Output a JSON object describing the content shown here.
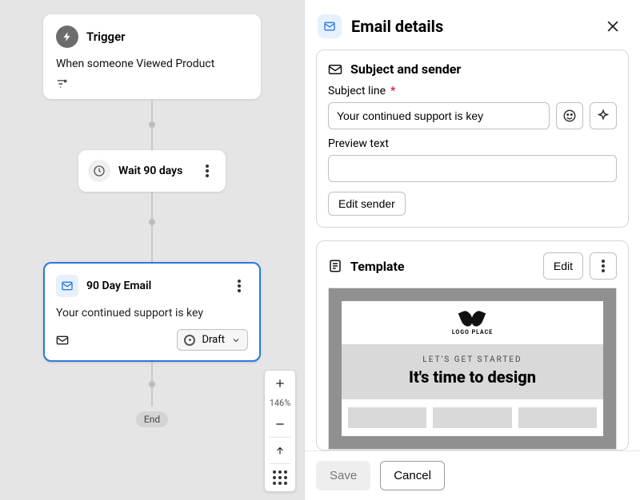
{
  "flow": {
    "trigger": {
      "title": "Trigger",
      "body": "When someone Viewed Product"
    },
    "wait": {
      "label": "Wait 90 days"
    },
    "email": {
      "name": "90 Day Email",
      "subject": "Your continued support is key",
      "status_label": "Draft"
    },
    "end": "End"
  },
  "zoom": {
    "level": "146%"
  },
  "panel": {
    "title": "Email details",
    "subject_sender": {
      "heading": "Subject and sender",
      "subject_label": "Subject line",
      "subject_value": "Your continued support is key",
      "preview_label": "Preview text",
      "preview_value": "",
      "edit_sender": "Edit sender"
    },
    "template": {
      "heading": "Template",
      "edit_label": "Edit",
      "logo_text": "LOGO PLACE",
      "kicker": "LET'S GET STARTED",
      "headline": "It's time to design"
    },
    "footer": {
      "save": "Save",
      "cancel": "Cancel"
    }
  }
}
